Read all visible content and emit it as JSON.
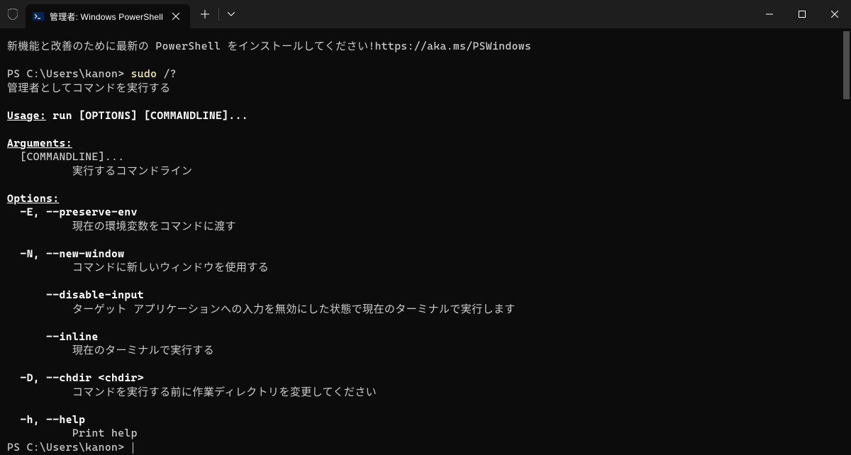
{
  "titlebar": {
    "tab_title": "管理者: Windows PowerShell"
  },
  "terminal": {
    "banner": "新機能と改善のために最新の PowerShell をインストールしてください!https://aka.ms/PSWindows",
    "prompt1_prefix": "PS C:\\Users\\kanon> ",
    "prompt1_cmd": "sudo",
    "prompt1_args": " /?",
    "help_title": "管理者としてコマンドを実行する",
    "usage_label": "Usage:",
    "usage_text": " run [OPTIONS] [COMMANDLINE]...",
    "arguments_label": "Arguments:",
    "arg_name": "  [COMMANDLINE]...",
    "arg_desc": "          実行するコマンドライン",
    "options_label": "Options:",
    "opt_E_flag": "  -E, --preserve-env",
    "opt_E_desc": "          現在の環境変数をコマンドに渡す",
    "opt_N_flag": "  -N, --new-window",
    "opt_N_desc": "          コマンドに新しいウィンドウを使用する",
    "opt_disable_flag": "      --disable-input",
    "opt_disable_desc": "          ターゲット アプリケーションへの入力を無効にした状態で現在のターミナルで実行します",
    "opt_inline_flag": "      --inline",
    "opt_inline_desc": "          現在のターミナルで実行する",
    "opt_D_flag": "  -D, --chdir <chdir>",
    "opt_D_desc": "          コマンドを実行する前に作業ディレクトリを変更してください",
    "opt_h_flag": "  -h, --help",
    "opt_h_desc": "          Print help",
    "prompt2": "PS C:\\Users\\kanon> "
  }
}
